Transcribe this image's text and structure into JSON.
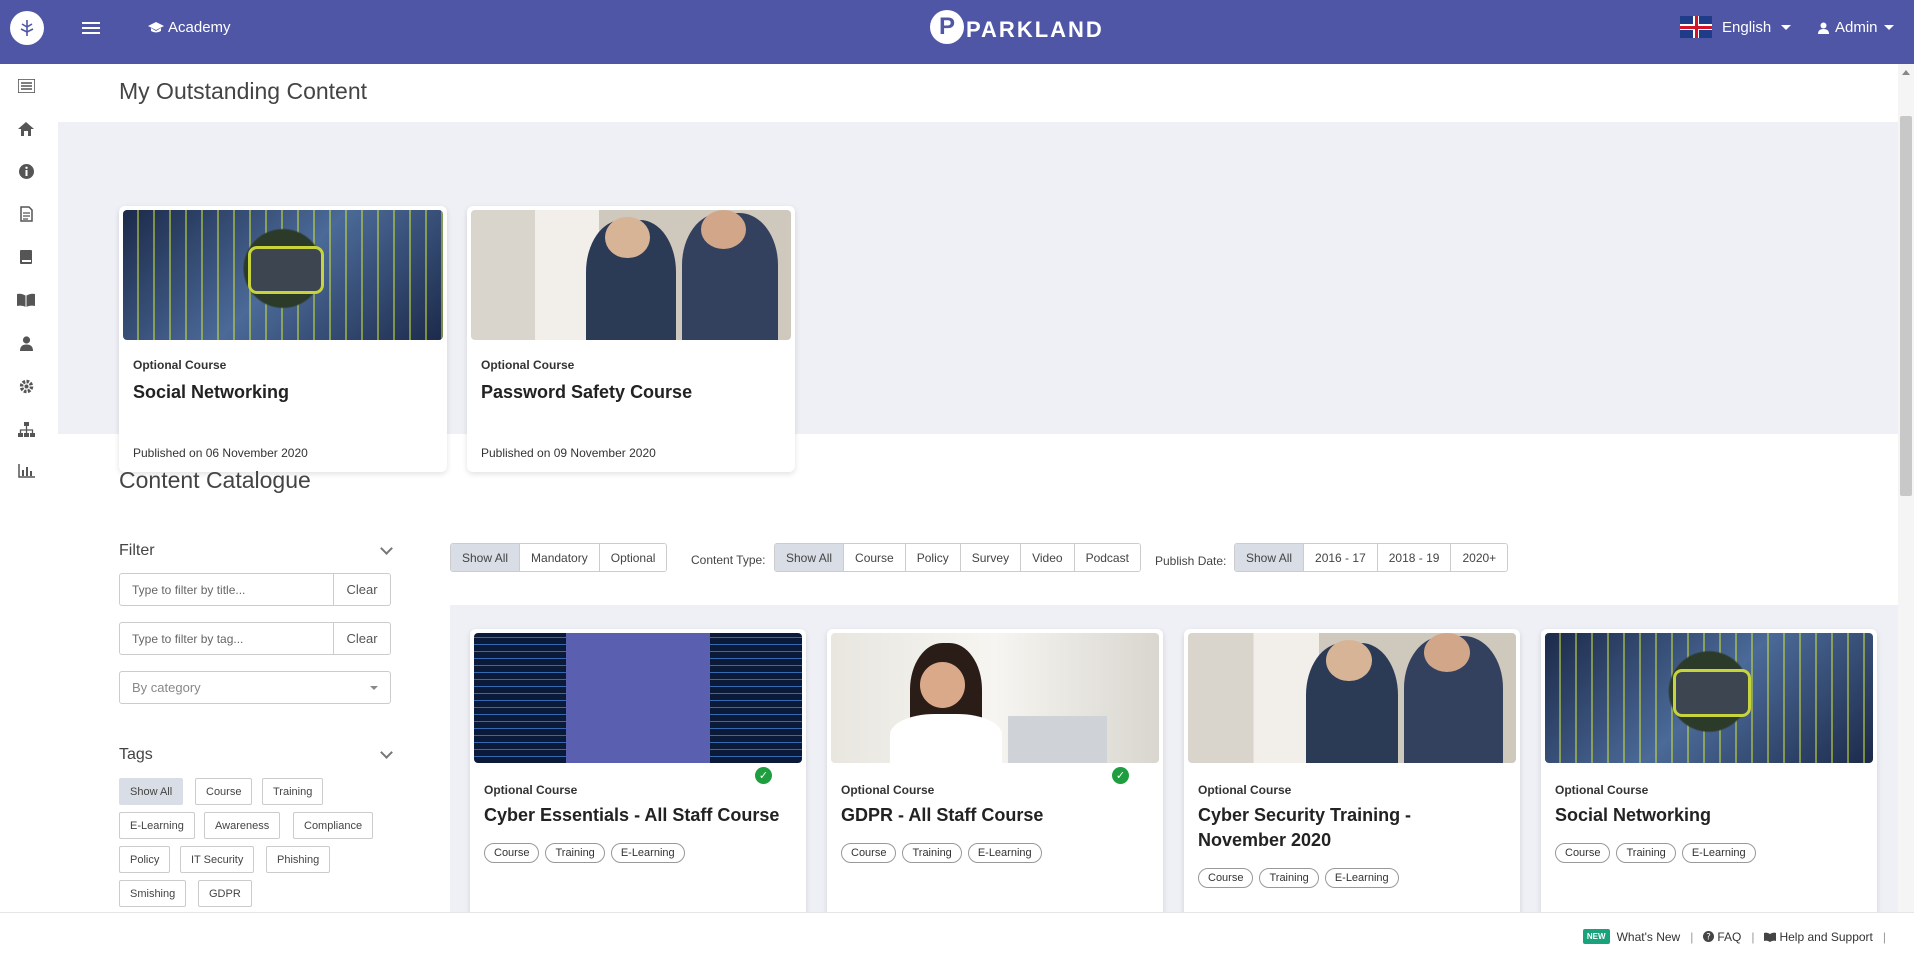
{
  "header": {
    "academy_label": "Academy",
    "brand_letter": "P",
    "brand_name": "PARKLAND",
    "language": "English",
    "user": "Admin"
  },
  "sidebar": {
    "icons": [
      "list-icon",
      "home-icon",
      "info-icon",
      "document-icon",
      "book-icon",
      "open-book-icon",
      "user-icon",
      "gear-icon",
      "sitemap-icon",
      "bar-chart-icon"
    ]
  },
  "outstanding": {
    "title": "My Outstanding Content",
    "cards": [
      {
        "kind": "Optional Course",
        "title": "Social Networking",
        "published": "Published on 06 November 2020"
      },
      {
        "kind": "Optional Course",
        "title": "Password Safety Course",
        "published": "Published on 09 November 2020"
      }
    ]
  },
  "catalogue": {
    "title": "Content Catalogue",
    "filter": {
      "heading": "Filter",
      "title_placeholder": "Type to filter by title...",
      "tag_placeholder": "Type to filter by tag...",
      "clear_label": "Clear",
      "category_placeholder": "By category"
    },
    "tags": {
      "heading": "Tags",
      "items": [
        "Show All",
        "Course",
        "Training",
        "E-Learning",
        "Awareness",
        "Compliance",
        "Policy",
        "IT Security",
        "Phishing",
        "Smishing",
        "GDPR"
      ]
    },
    "toolbar": {
      "requirement": [
        "Show All",
        "Mandatory",
        "Optional"
      ],
      "content_type_label": "Content Type:",
      "content_type": [
        "Show All",
        "Course",
        "Policy",
        "Survey",
        "Video",
        "Podcast"
      ],
      "publish_date_label": "Publish Date:",
      "publish_date": [
        "Show All",
        "2016 - 17",
        "2018 - 19",
        "2020+"
      ]
    },
    "cards": [
      {
        "kind": "Optional Course",
        "title": "Cyber Essentials - All Staff Course",
        "completed": true,
        "tags": [
          "Course",
          "Training",
          "E-Learning"
        ]
      },
      {
        "kind": "Optional Course",
        "title": "GDPR - All Staff Course",
        "completed": true,
        "tags": [
          "Course",
          "Training",
          "E-Learning"
        ]
      },
      {
        "kind": "Optional Course",
        "title": "Cyber Security Training - November 2020",
        "completed": false,
        "tags": [
          "Course",
          "Training",
          "E-Learning"
        ]
      },
      {
        "kind": "Optional Course",
        "title": "Social Networking",
        "completed": false,
        "tags": [
          "Course",
          "Training",
          "E-Learning"
        ]
      }
    ]
  },
  "footer": {
    "new_badge": "NEW",
    "whats_new": "What's New",
    "faq": "FAQ",
    "help": "Help and Support"
  },
  "colors": {
    "header_bg": "#4f56a6",
    "band_bg": "#eef0f5",
    "check_green": "#1e9e3e",
    "new_badge": "#1aa37a"
  }
}
